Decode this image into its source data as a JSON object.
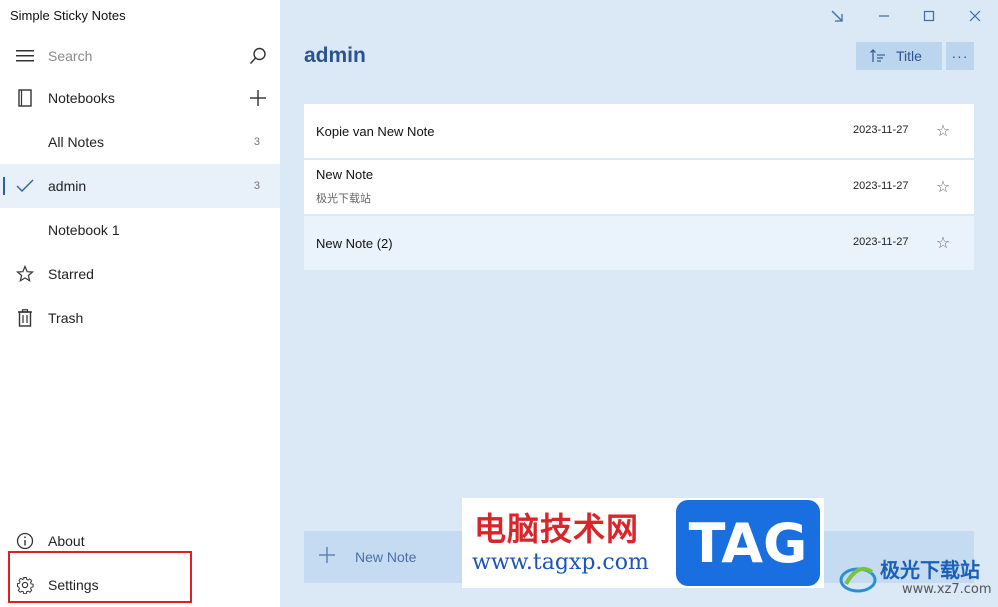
{
  "app": {
    "title": "Simple Sticky Notes"
  },
  "sidebar": {
    "search_placeholder": "Search",
    "notebooks_label": "Notebooks",
    "items": [
      {
        "label": "All Notes",
        "count": "3"
      },
      {
        "label": "admin",
        "count": "3",
        "selected": true
      },
      {
        "label": "Notebook 1",
        "count": ""
      }
    ],
    "starred_label": "Starred",
    "trash_label": "Trash",
    "about_label": "About",
    "settings_label": "Settings"
  },
  "main": {
    "title": "admin",
    "sort_label": "Title",
    "more_label": "···",
    "notes": [
      {
        "title": "Kopie van New Note",
        "preview": "",
        "date": "2023-11-27"
      },
      {
        "title": "New Note",
        "preview": "极光下载站",
        "date": "2023-11-27"
      },
      {
        "title": "New Note (2)",
        "preview": "",
        "date": "2023-11-27"
      }
    ],
    "new_note_label": "New Note"
  },
  "watermark": {
    "cn_text": "电脑技术网",
    "url": "www.tagxp.com",
    "tag": "TAG",
    "site_name": "极光下载站",
    "site_url": "www.xz7.com"
  },
  "colors": {
    "accent": "#2c5391",
    "main_bg": "#dbe8f6",
    "selected_bg": "#e8f0f9",
    "highlight_box": "#e02020"
  }
}
